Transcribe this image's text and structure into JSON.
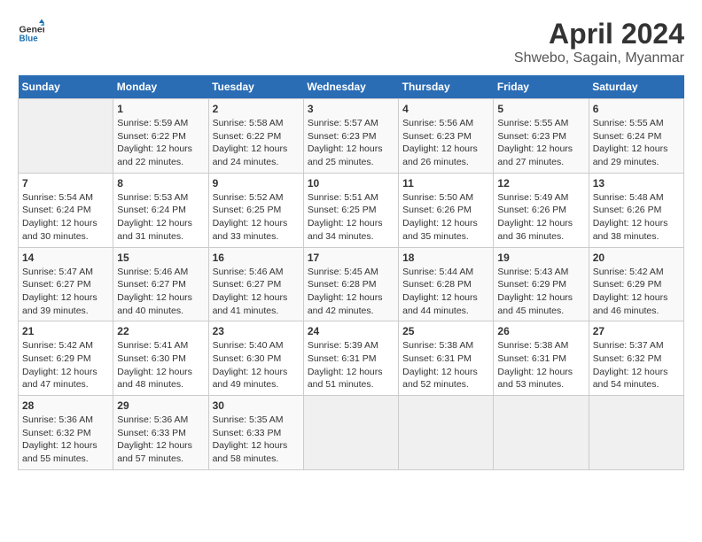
{
  "header": {
    "logo_line1": "General",
    "logo_line2": "Blue",
    "title": "April 2024",
    "subtitle": "Shwebo, Sagain, Myanmar"
  },
  "calendar": {
    "days_of_week": [
      "Sunday",
      "Monday",
      "Tuesday",
      "Wednesday",
      "Thursday",
      "Friday",
      "Saturday"
    ],
    "weeks": [
      [
        {
          "day": "",
          "info": ""
        },
        {
          "day": "1",
          "info": "Sunrise: 5:59 AM\nSunset: 6:22 PM\nDaylight: 12 hours\nand 22 minutes."
        },
        {
          "day": "2",
          "info": "Sunrise: 5:58 AM\nSunset: 6:22 PM\nDaylight: 12 hours\nand 24 minutes."
        },
        {
          "day": "3",
          "info": "Sunrise: 5:57 AM\nSunset: 6:23 PM\nDaylight: 12 hours\nand 25 minutes."
        },
        {
          "day": "4",
          "info": "Sunrise: 5:56 AM\nSunset: 6:23 PM\nDaylight: 12 hours\nand 26 minutes."
        },
        {
          "day": "5",
          "info": "Sunrise: 5:55 AM\nSunset: 6:23 PM\nDaylight: 12 hours\nand 27 minutes."
        },
        {
          "day": "6",
          "info": "Sunrise: 5:55 AM\nSunset: 6:24 PM\nDaylight: 12 hours\nand 29 minutes."
        }
      ],
      [
        {
          "day": "7",
          "info": "Sunrise: 5:54 AM\nSunset: 6:24 PM\nDaylight: 12 hours\nand 30 minutes."
        },
        {
          "day": "8",
          "info": "Sunrise: 5:53 AM\nSunset: 6:24 PM\nDaylight: 12 hours\nand 31 minutes."
        },
        {
          "day": "9",
          "info": "Sunrise: 5:52 AM\nSunset: 6:25 PM\nDaylight: 12 hours\nand 33 minutes."
        },
        {
          "day": "10",
          "info": "Sunrise: 5:51 AM\nSunset: 6:25 PM\nDaylight: 12 hours\nand 34 minutes."
        },
        {
          "day": "11",
          "info": "Sunrise: 5:50 AM\nSunset: 6:26 PM\nDaylight: 12 hours\nand 35 minutes."
        },
        {
          "day": "12",
          "info": "Sunrise: 5:49 AM\nSunset: 6:26 PM\nDaylight: 12 hours\nand 36 minutes."
        },
        {
          "day": "13",
          "info": "Sunrise: 5:48 AM\nSunset: 6:26 PM\nDaylight: 12 hours\nand 38 minutes."
        }
      ],
      [
        {
          "day": "14",
          "info": "Sunrise: 5:47 AM\nSunset: 6:27 PM\nDaylight: 12 hours\nand 39 minutes."
        },
        {
          "day": "15",
          "info": "Sunrise: 5:46 AM\nSunset: 6:27 PM\nDaylight: 12 hours\nand 40 minutes."
        },
        {
          "day": "16",
          "info": "Sunrise: 5:46 AM\nSunset: 6:27 PM\nDaylight: 12 hours\nand 41 minutes."
        },
        {
          "day": "17",
          "info": "Sunrise: 5:45 AM\nSunset: 6:28 PM\nDaylight: 12 hours\nand 42 minutes."
        },
        {
          "day": "18",
          "info": "Sunrise: 5:44 AM\nSunset: 6:28 PM\nDaylight: 12 hours\nand 44 minutes."
        },
        {
          "day": "19",
          "info": "Sunrise: 5:43 AM\nSunset: 6:29 PM\nDaylight: 12 hours\nand 45 minutes."
        },
        {
          "day": "20",
          "info": "Sunrise: 5:42 AM\nSunset: 6:29 PM\nDaylight: 12 hours\nand 46 minutes."
        }
      ],
      [
        {
          "day": "21",
          "info": "Sunrise: 5:42 AM\nSunset: 6:29 PM\nDaylight: 12 hours\nand 47 minutes."
        },
        {
          "day": "22",
          "info": "Sunrise: 5:41 AM\nSunset: 6:30 PM\nDaylight: 12 hours\nand 48 minutes."
        },
        {
          "day": "23",
          "info": "Sunrise: 5:40 AM\nSunset: 6:30 PM\nDaylight: 12 hours\nand 49 minutes."
        },
        {
          "day": "24",
          "info": "Sunrise: 5:39 AM\nSunset: 6:31 PM\nDaylight: 12 hours\nand 51 minutes."
        },
        {
          "day": "25",
          "info": "Sunrise: 5:38 AM\nSunset: 6:31 PM\nDaylight: 12 hours\nand 52 minutes."
        },
        {
          "day": "26",
          "info": "Sunrise: 5:38 AM\nSunset: 6:31 PM\nDaylight: 12 hours\nand 53 minutes."
        },
        {
          "day": "27",
          "info": "Sunrise: 5:37 AM\nSunset: 6:32 PM\nDaylight: 12 hours\nand 54 minutes."
        }
      ],
      [
        {
          "day": "28",
          "info": "Sunrise: 5:36 AM\nSunset: 6:32 PM\nDaylight: 12 hours\nand 55 minutes."
        },
        {
          "day": "29",
          "info": "Sunrise: 5:36 AM\nSunset: 6:33 PM\nDaylight: 12 hours\nand 57 minutes."
        },
        {
          "day": "30",
          "info": "Sunrise: 5:35 AM\nSunset: 6:33 PM\nDaylight: 12 hours\nand 58 minutes."
        },
        {
          "day": "",
          "info": ""
        },
        {
          "day": "",
          "info": ""
        },
        {
          "day": "",
          "info": ""
        },
        {
          "day": "",
          "info": ""
        }
      ]
    ]
  }
}
